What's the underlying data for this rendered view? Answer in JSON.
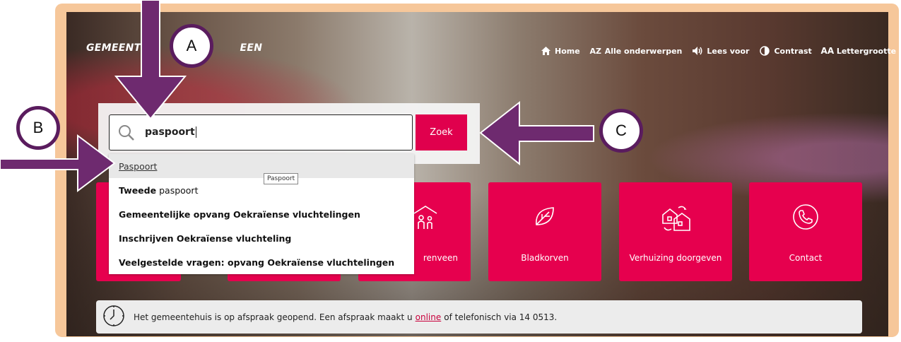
{
  "header": {
    "logo_left": "GEMEENT",
    "logo_right": "EEN",
    "nav": [
      {
        "icon": "home-icon",
        "label": "Home"
      },
      {
        "icon": "az-icon",
        "label": "Alle onderwerpen",
        "glyph": "AZ"
      },
      {
        "icon": "speaker-icon",
        "label": "Lees voor"
      },
      {
        "icon": "contrast-icon",
        "label": "Contrast"
      },
      {
        "icon": "font-size-icon",
        "label": "Lettergrootte",
        "glyph": "AA"
      }
    ]
  },
  "search": {
    "value": "paspoort",
    "button_label": "Zoek",
    "suggestions": [
      {
        "bold": "",
        "text": "Paspoort"
      },
      {
        "bold": "Tweede",
        "text": "paspoort"
      },
      {
        "bold": "Gemeentelijke opvang Oekraïense vluchtelingen",
        "text": ""
      },
      {
        "bold": "Inschrijven Oekraïense vluchteling",
        "text": ""
      },
      {
        "bold": "Veelgestelde vragen: opvang Oekraïense vluchtelingen",
        "text": ""
      }
    ],
    "tooltip": "Paspoort"
  },
  "tiles": [
    {
      "label": "renveen",
      "icon": "family-icon"
    },
    {
      "label": "Bladkorven",
      "icon": "leaf-icon"
    },
    {
      "label": "Verhuizing doorgeven",
      "icon": "move-house-icon"
    },
    {
      "label": "Contact",
      "icon": "phone-icon"
    }
  ],
  "notice": {
    "before": "Het gemeentehuis is op afspraak geopend. Een afspraak maakt u",
    "link": "online",
    "after": "of telefonisch via 14 0513."
  },
  "annotations": {
    "a": "A",
    "b": "B",
    "c": "C",
    "color": "#5a1c5e"
  },
  "colors": {
    "accent": "#e0004d",
    "frame": "#f6c79a"
  }
}
